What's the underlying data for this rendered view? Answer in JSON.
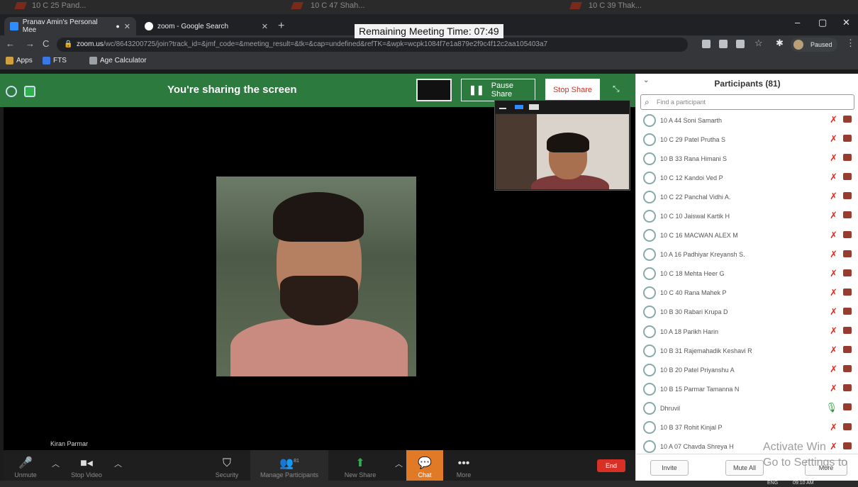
{
  "browser": {
    "background_tabs": [
      "10 C 25 Pand...",
      "10 C 47 Shah...",
      "10 C 39 Thak..."
    ],
    "tabs": [
      {
        "label": "Pranav Amin's Personal Mee",
        "active": true
      },
      {
        "label": "zoom - Google Search",
        "active": false
      }
    ],
    "url_host": "zoom.us",
    "url_path": "/wc/8643200725/join?track_id=&jmf_code=&meeting_result=&tk=&cap=undefined&refTK=&wpk=wcpk1084f7e1a879e2f9c4f12c2aa105403a7",
    "paused_label": "Paused",
    "bookmarks": [
      "Apps",
      "FTS",
      "Age Calculator"
    ]
  },
  "meeting": {
    "remaining_time": "Remaining Meeting Time: 07:49",
    "sharing_title": "You're sharing the screen",
    "pause_share": "Pause Share",
    "stop_share": "Stop Share",
    "speaker_name": "Kiran Parmar"
  },
  "toolbar": {
    "unmute": "Unmute",
    "stop_video": "Stop Video",
    "security": "Security",
    "manage_participants": "Manage Participants",
    "participant_count": "81",
    "new_share": "New Share",
    "chat": "Chat",
    "more": "More",
    "end": "End"
  },
  "participants": {
    "title": "Participants (81)",
    "search_placeholder": "Find a participant",
    "list": [
      {
        "name": "10 A 44 Soni Samarth",
        "mic": "muted"
      },
      {
        "name": "10 C 29 Patel Prutha S",
        "mic": "muted"
      },
      {
        "name": "10 B 33 Rana Himani S",
        "mic": "muted"
      },
      {
        "name": "10 C 12 Kandoi Ved P",
        "mic": "muted"
      },
      {
        "name": "10 C 22 Panchal Vidhi A.",
        "mic": "muted"
      },
      {
        "name": "10 C 10 Jaiswal Kartik H",
        "mic": "muted"
      },
      {
        "name": "10 C 16 MACWAN ALEX M",
        "mic": "muted"
      },
      {
        "name": "10 A 16 Padhiyar Kreyansh S.",
        "mic": "muted"
      },
      {
        "name": "10 C 18 Mehta Heer G",
        "mic": "muted"
      },
      {
        "name": "10 C 40 Rana Mahek P",
        "mic": "muted"
      },
      {
        "name": "10 B 30 Rabari Krupa D",
        "mic": "muted"
      },
      {
        "name": "10 A 18 Parikh Harin",
        "mic": "muted"
      },
      {
        "name": "10 B 31 Rajemahadik Keshavi R",
        "mic": "muted"
      },
      {
        "name": "10 B 20 Patel Priyanshu A",
        "mic": "muted"
      },
      {
        "name": "10 B 15 Parmar Tamanna N",
        "mic": "muted"
      },
      {
        "name": "Dhruvil",
        "mic": "on"
      },
      {
        "name": "10 B 37 Rohit Kinjal P",
        "mic": "muted"
      },
      {
        "name": "10 A 07 Chavda Shreya H",
        "mic": "muted"
      }
    ],
    "invite": "Invite",
    "mute_all": "Mute All",
    "more": "More"
  },
  "watermark": {
    "line1": "Activate Win",
    "line2": "Go to Settings to"
  },
  "taskbar": {
    "lang": "ENG",
    "time": "09:10 AM"
  }
}
